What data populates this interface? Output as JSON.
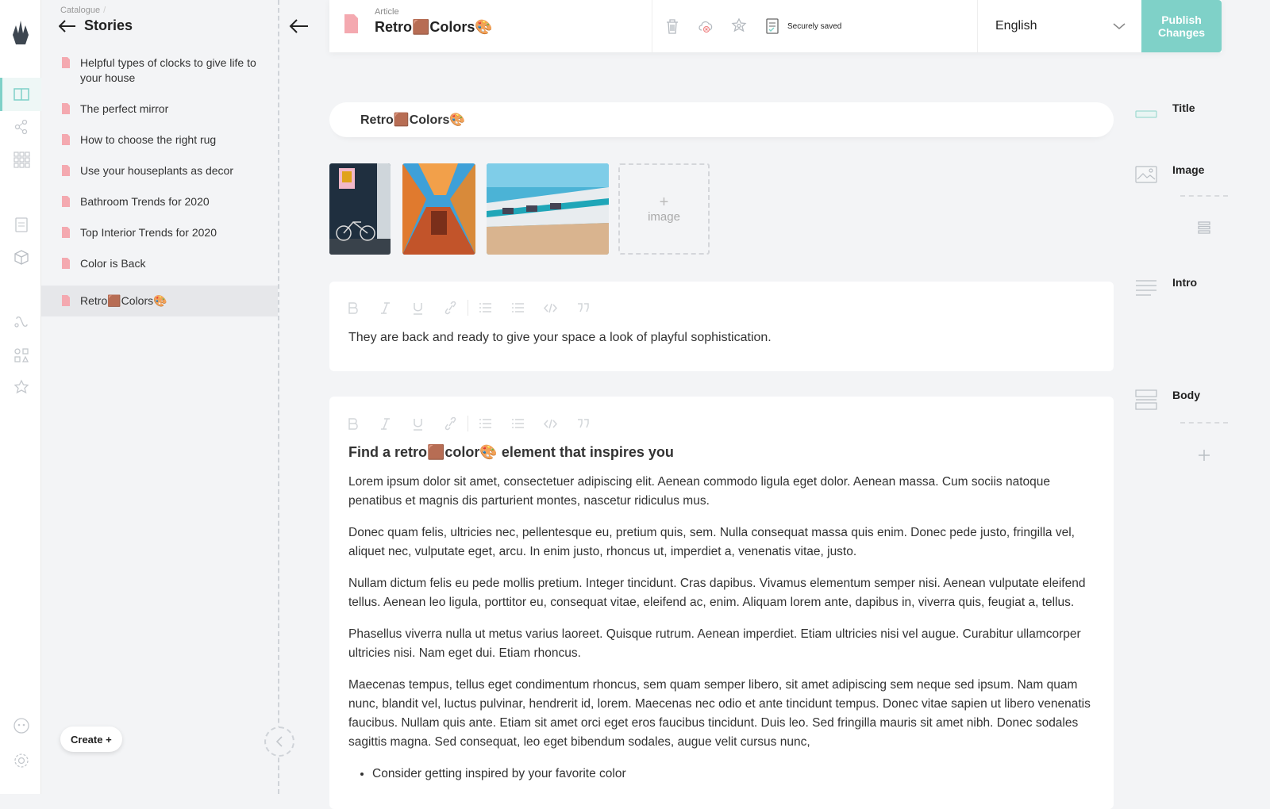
{
  "sidebar": {
    "breadcrumb": "Catalogue",
    "breadcrumb_sep": "/",
    "title": "Stories",
    "items": [
      {
        "label": "Helpful types of clocks to give life to your house"
      },
      {
        "label": "The perfect mirror"
      },
      {
        "label": "How to choose the right rug"
      },
      {
        "label": "Use your houseplants as decor"
      },
      {
        "label": "Bathroom Trends for 2020"
      },
      {
        "label": "Top Interior Trends for 2020"
      },
      {
        "label": "Color is Back"
      },
      {
        "label": "Retro🟫Colors🎨"
      }
    ],
    "create_label": "Create +"
  },
  "header": {
    "kind": "Article",
    "title": "Retro🟫Colors🎨",
    "save_status": "Securely saved",
    "language": "English",
    "publish_label": "Publish Changes"
  },
  "editor": {
    "title_value": "Retro🟫Colors🎨",
    "add_image_label": "image",
    "add_image_plus": "+",
    "intro": "They are back and ready to give your space a look of playful sophistication.",
    "body_heading": "Find a retro🟫color🎨 element that inspires you",
    "body_paragraphs": [
      "Lorem ipsum dolor sit amet, consectetuer adipiscing elit. Aenean commodo ligula eget dolor. Aenean massa. Cum sociis natoque penatibus et magnis dis parturient montes, nascetur ridiculus mus.",
      "Donec quam felis, ultricies nec, pellentesque eu, pretium quis, sem. Nulla consequat massa quis enim. Donec pede justo, fringilla vel, aliquet nec, vulputate eget, arcu. In enim justo, rhoncus ut, imperdiet a, venenatis vitae, justo.",
      "Nullam dictum felis eu pede mollis pretium. Integer tincidunt. Cras dapibus. Vivamus elementum semper nisi. Aenean vulputate eleifend tellus. Aenean leo ligula, porttitor eu, consequat vitae, eleifend ac, enim. Aliquam lorem ante, dapibus in, viverra quis, feugiat a, tellus.",
      "Phasellus viverra nulla ut metus varius laoreet. Quisque rutrum. Aenean imperdiet. Etiam ultricies nisi vel augue. Curabitur ullamcorper ultricies nisi. Nam eget dui. Etiam rhoncus.",
      "Maecenas tempus, tellus eget condimentum rhoncus, sem quam semper libero, sit amet adipiscing sem neque sed ipsum. Nam quam nunc, blandit vel, luctus pulvinar, hendrerit id, lorem. Maecenas nec odio et ante tincidunt tempus. Donec vitae sapien ut libero venenatis faucibus. Nullam quis ante. Etiam sit amet orci eget eros faucibus tincidunt. Duis leo. Sed fringilla mauris sit amet nibh. Donec sodales sagittis magna. Sed consequat, leo eget bibendum sodales, augue velit cursus nunc,"
    ],
    "body_bullet": "Consider getting inspired by your favorite color"
  },
  "blocks": {
    "title": "Title",
    "image": "Image",
    "intro": "Intro",
    "body": "Body"
  },
  "colors": {
    "accent": "#7fd1c8",
    "doc_icon": "#f4a9b0",
    "background": "#f3f4f6"
  }
}
